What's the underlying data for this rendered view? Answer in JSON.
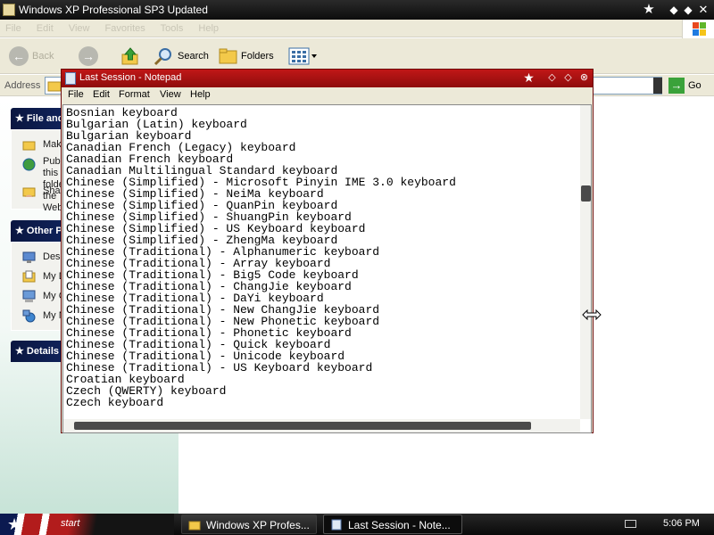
{
  "explorer": {
    "title": "Windows XP Professional SP3 Updated",
    "menu": [
      "File",
      "Edit",
      "View",
      "Favorites",
      "Tools",
      "Help"
    ],
    "toolbar": {
      "back": "Back",
      "search": "Search",
      "folders": "Folders"
    },
    "address": {
      "label": "Address",
      "go": "Go"
    },
    "task_groups": [
      {
        "title": "File and Folder Tasks",
        "items": [
          "Make a new folder",
          "Publish this folder to the Web",
          "Share this folder"
        ]
      },
      {
        "title": "Other Places",
        "items": [
          "Desktop",
          "My Documents",
          "My Computer",
          "My Network Places"
        ]
      },
      {
        "title": "Details",
        "items": []
      }
    ]
  },
  "notepad": {
    "title": "Last Session - Notepad",
    "menu": [
      "File",
      "Edit",
      "Format",
      "View",
      "Help"
    ],
    "lines": [
      "Bosnian keyboard",
      "Bulgarian (Latin) keyboard",
      "Bulgarian keyboard",
      "Canadian French (Legacy) keyboard",
      "Canadian French keyboard",
      "Canadian Multilingual Standard keyboard",
      "Chinese (Simplified) - Microsoft Pinyin IME 3.0 keyboard",
      "Chinese (Simplified) - NeiMa keyboard",
      "Chinese (Simplified) - QuanPin keyboard",
      "Chinese (Simplified) - ShuangPin keyboard",
      "Chinese (Simplified) - US Keyboard keyboard",
      "Chinese (Simplified) - ZhengMa keyboard",
      "Chinese (Traditional) - Alphanumeric keyboard",
      "Chinese (Traditional) - Array keyboard",
      "Chinese (Traditional) - Big5 Code keyboard",
      "Chinese (Traditional) - ChangJie keyboard",
      "Chinese (Traditional) - DaYi keyboard",
      "Chinese (Traditional) - New ChangJie keyboard",
      "Chinese (Traditional) - New Phonetic keyboard",
      "Chinese (Traditional) - Phonetic keyboard",
      "Chinese (Traditional) - Quick keyboard",
      "Chinese (Traditional) - Unicode keyboard",
      "Chinese (Traditional) - US Keyboard keyboard",
      "Croatian keyboard",
      "Czech (QWERTY) keyboard",
      "Czech keyboard"
    ],
    "vertical_scroll_position": 0.27
  },
  "taskbar": {
    "start": "start",
    "tasks": [
      {
        "label": "Windows XP Profes...",
        "active": false
      },
      {
        "label": "Last Session - Note...",
        "active": true
      }
    ],
    "clock": "5:06 PM"
  },
  "colors": {
    "notepad_title": "#b01414",
    "task_header": "#0a1640",
    "taskbar": "#1a1a1a"
  }
}
